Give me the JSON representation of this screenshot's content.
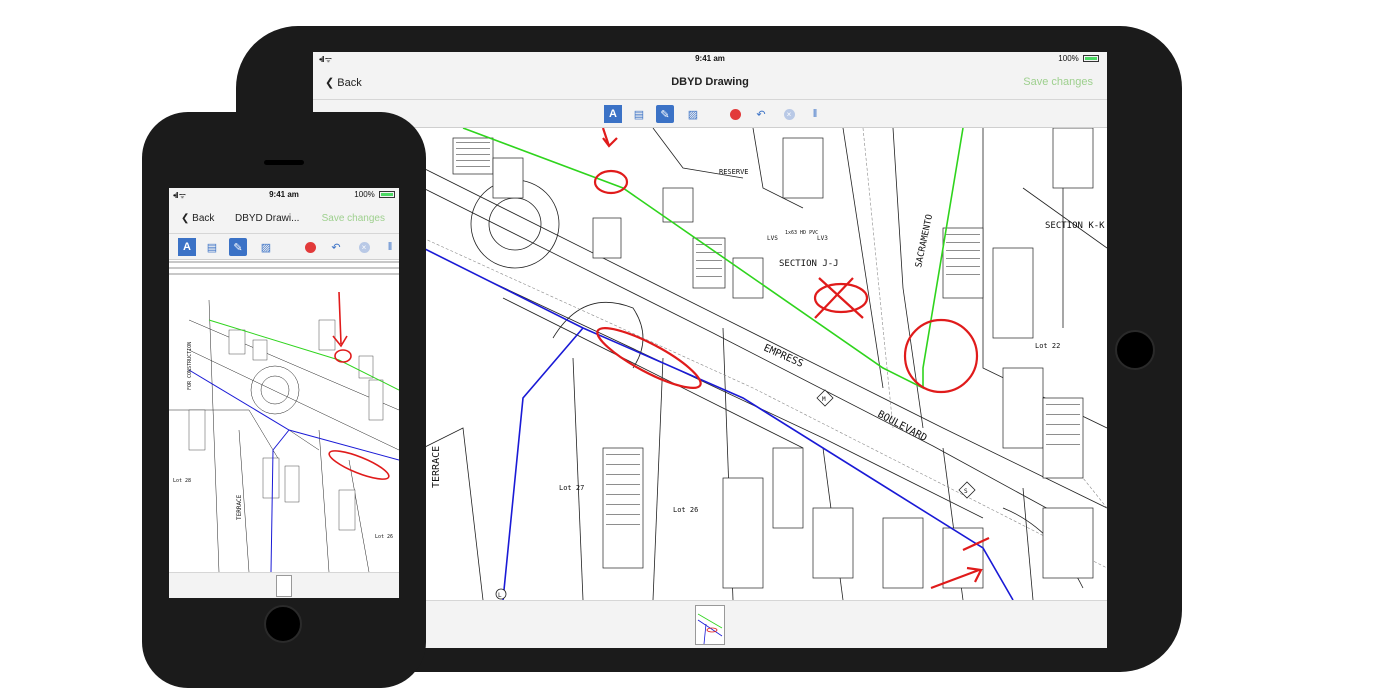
{
  "status_bar": {
    "signal": "•ıll ᯤ",
    "time": "9:41 am",
    "battery": "100%"
  },
  "navigation": {
    "back_label": "Back",
    "title": "DBYD Drawing",
    "title_phone": "DBYD Drawi...",
    "save_label": "Save changes"
  },
  "toolbar": {
    "tools": [
      {
        "name": "text",
        "icon": "text-tool-icon",
        "glyph": "A"
      },
      {
        "name": "comment",
        "icon": "comment-icon",
        "glyph": "▤"
      },
      {
        "name": "pen",
        "icon": "pen-icon",
        "glyph": "✎"
      },
      {
        "name": "image",
        "icon": "image-icon",
        "glyph": "▨"
      },
      {
        "name": "record",
        "icon": "record-icon",
        "glyph": ""
      },
      {
        "name": "undo",
        "icon": "undo-icon",
        "glyph": "↶"
      },
      {
        "name": "clear",
        "icon": "clear-icon",
        "glyph": "×"
      },
      {
        "name": "separator",
        "icon": "divider-icon",
        "glyph": "‖"
      }
    ]
  },
  "drawing": {
    "labels": {
      "reserve": "RESERVE",
      "section_jj": "SECTION J-J",
      "section_kk": "SECTION K-K",
      "empress": "EMPRESS",
      "boulevard": "BOULEVARD",
      "sacramento": "SACRAMENTO",
      "terrace": "TERRACE",
      "lot_22": "Lot 22",
      "lot_26": "Lot 26",
      "lot_27": "Lot 27",
      "marker_m": "M",
      "marker_s": "S",
      "marker_l": "L",
      "lv3": "LV3",
      "lvs": "LVS",
      "pvc": "1x63 HD PVC"
    },
    "phone_labels": {
      "terrace": "TERRACE",
      "lot_26": "Lot 26",
      "lot_28": "Lot 28",
      "for_construction": "FOR CONSTRUCTION"
    },
    "colors": {
      "green_line": "#2fd41d",
      "blue_line": "#1a1ad6",
      "markup_red": "#e01b1b"
    }
  }
}
